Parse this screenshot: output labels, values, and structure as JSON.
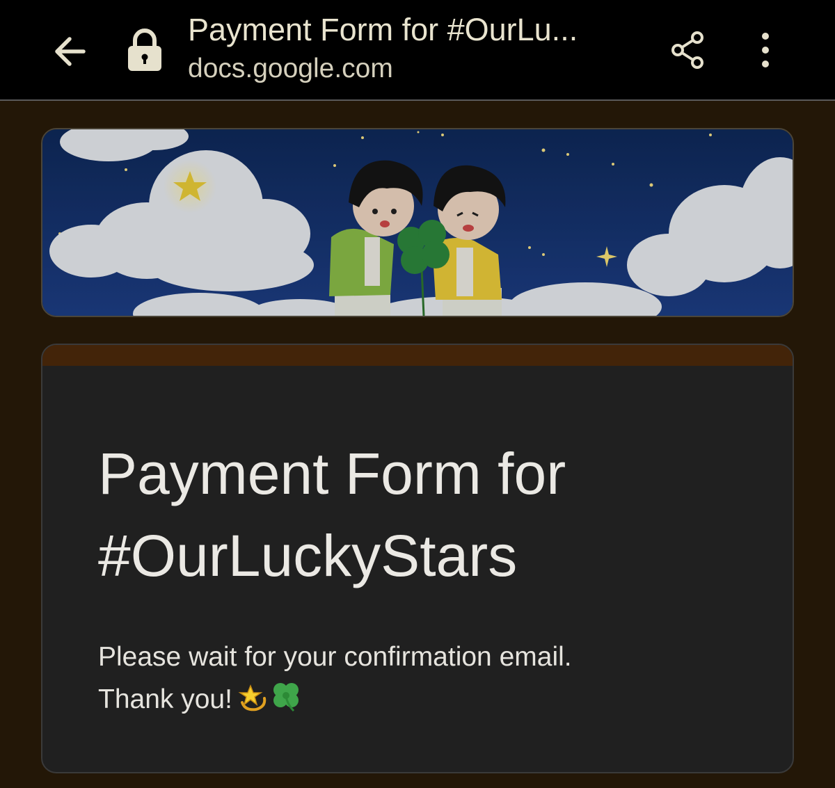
{
  "browser": {
    "page_title": "Payment Form for #OurLu...",
    "url": "docs.google.com",
    "icons": {
      "back": "arrow-back-icon",
      "lock": "lock-icon",
      "share": "share-icon",
      "menu": "more-vert-icon"
    }
  },
  "banner": {
    "description_icon": "banner-image"
  },
  "form": {
    "title": "Payment Form for #OurLuckyStars",
    "message_line1": "Please wait for your confirmation email.",
    "message_line2": "Thank you!",
    "emojis": [
      "dizzy-star-icon",
      "four-leaf-clover-icon"
    ]
  },
  "colors": {
    "toolbar_bg": "#000000",
    "page_bg": "#231707",
    "card_bg": "#202020",
    "card_accent": "#432409",
    "text_primary": "#ebe9e4"
  }
}
